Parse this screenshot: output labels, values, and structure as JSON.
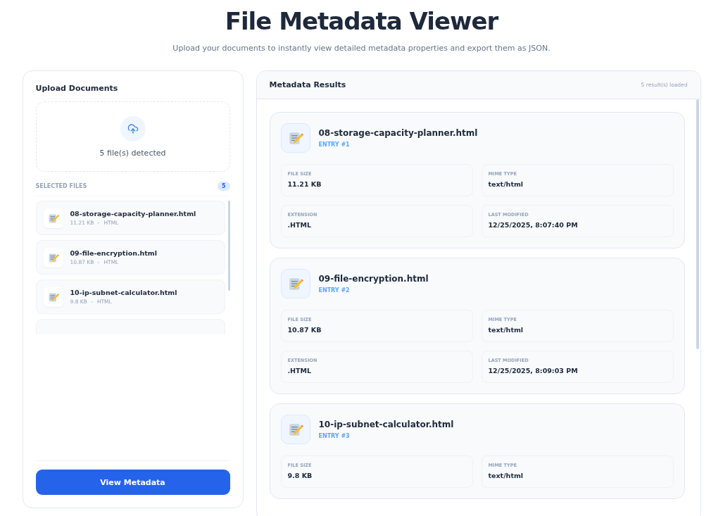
{
  "page": {
    "title": "File Metadata Viewer",
    "subtitle": "Upload your documents to instantly view detailed metadata properties and export them as JSON."
  },
  "upload": {
    "title": "Upload Documents",
    "dropzone_text": "5 file(s) detected",
    "selected_label": "SELECTED FILES",
    "count": "5",
    "files": [
      {
        "name": "08-storage-capacity-planner.html",
        "size": "11.21 KB",
        "type": "HTML"
      },
      {
        "name": "09-file-encryption.html",
        "size": "10.87 KB",
        "type": "HTML"
      },
      {
        "name": "10-ip-subnet-calculator.html",
        "size": "9.8 KB",
        "type": "HTML"
      }
    ],
    "button": "View Metadata"
  },
  "results": {
    "title": "Metadata Results",
    "status": "5 result(s) loaded",
    "entries": [
      {
        "name": "08-storage-capacity-planner.html",
        "entry": "ENTRY #1",
        "fields": [
          {
            "label": "FILE SIZE",
            "value": "11.21 KB"
          },
          {
            "label": "MIME TYPE",
            "value": "text/html"
          },
          {
            "label": "EXTENSION",
            "value": ".HTML"
          },
          {
            "label": "LAST MODIFIED",
            "value": "12/25/2025, 8:07:40 PM"
          }
        ]
      },
      {
        "name": "09-file-encryption.html",
        "entry": "ENTRY #2",
        "fields": [
          {
            "label": "FILE SIZE",
            "value": "10.87 KB"
          },
          {
            "label": "MIME TYPE",
            "value": "text/html"
          },
          {
            "label": "EXTENSION",
            "value": ".HTML"
          },
          {
            "label": "LAST MODIFIED",
            "value": "12/25/2025, 8:09:03 PM"
          }
        ]
      },
      {
        "name": "10-ip-subnet-calculator.html",
        "entry": "ENTRY #3",
        "fields": [
          {
            "label": "FILE SIZE",
            "value": "9.8 KB"
          },
          {
            "label": "MIME TYPE",
            "value": "text/html"
          }
        ]
      }
    ]
  }
}
